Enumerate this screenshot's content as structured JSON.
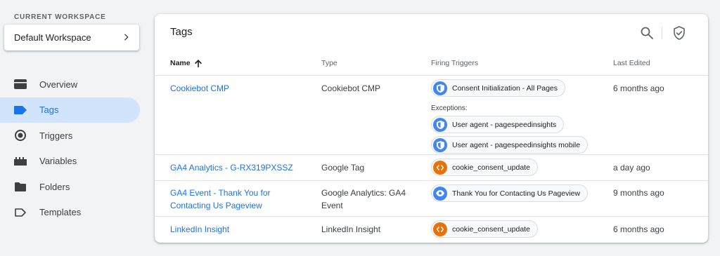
{
  "sidebar": {
    "workspace_label": "CURRENT WORKSPACE",
    "workspace_name": "Default Workspace",
    "items": [
      {
        "label": "Overview",
        "icon": "overview-icon"
      },
      {
        "label": "Tags",
        "icon": "tag-icon",
        "active": true
      },
      {
        "label": "Triggers",
        "icon": "trigger-icon"
      },
      {
        "label": "Variables",
        "icon": "variables-icon"
      },
      {
        "label": "Folders",
        "icon": "folder-icon"
      },
      {
        "label": "Templates",
        "icon": "template-icon"
      }
    ]
  },
  "main": {
    "title": "Tags",
    "columns": {
      "name": "Name",
      "type": "Type",
      "triggers": "Firing Triggers",
      "edited": "Last Edited"
    },
    "exceptions_label": "Exceptions:",
    "rows": [
      {
        "name": "Cookiebot CMP",
        "type": "Cookiebot CMP",
        "trigger": "Consent Initialization - All Pages",
        "exceptions": [
          "User agent - pagespeedinsights",
          "User agent - pagespeedinsights mobile"
        ],
        "edited": "6 months ago"
      },
      {
        "name": "GA4 Analytics - G-RX319PXSSZ",
        "type": "Google Tag",
        "trigger": "cookie_consent_update",
        "edited": "a day ago"
      },
      {
        "name": "GA4 Event - Thank You for Contacting Us Pageview",
        "type": "Google Analytics: GA4 Event",
        "trigger": "Thank You for Contacting Us Pageview",
        "edited": "9 months ago"
      },
      {
        "name": "LinkedIn Insight",
        "type": "LinkedIn Insight",
        "trigger": "cookie_consent_update",
        "edited": "6 months ago"
      }
    ]
  },
  "colors": {
    "accent": "#1a73e8",
    "active_bg": "#d2e3fc",
    "trigger_blue": "#4285f4",
    "trigger_orange": "#e8710a"
  }
}
